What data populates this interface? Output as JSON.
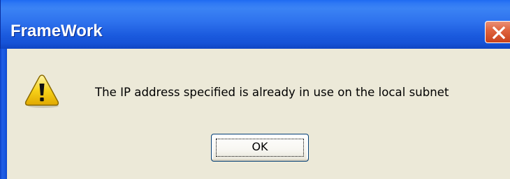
{
  "window": {
    "title": "FrameWork"
  },
  "dialog": {
    "message": "The IP address specified is already in use on the local subnet",
    "icon": "warning-icon",
    "buttons": {
      "ok_label": "OK"
    }
  },
  "colors": {
    "titlebar": "#2f73ee",
    "close_button": "#e0643f",
    "dialog_background": "#ece9d8",
    "warning_yellow": "#f7d21a"
  }
}
